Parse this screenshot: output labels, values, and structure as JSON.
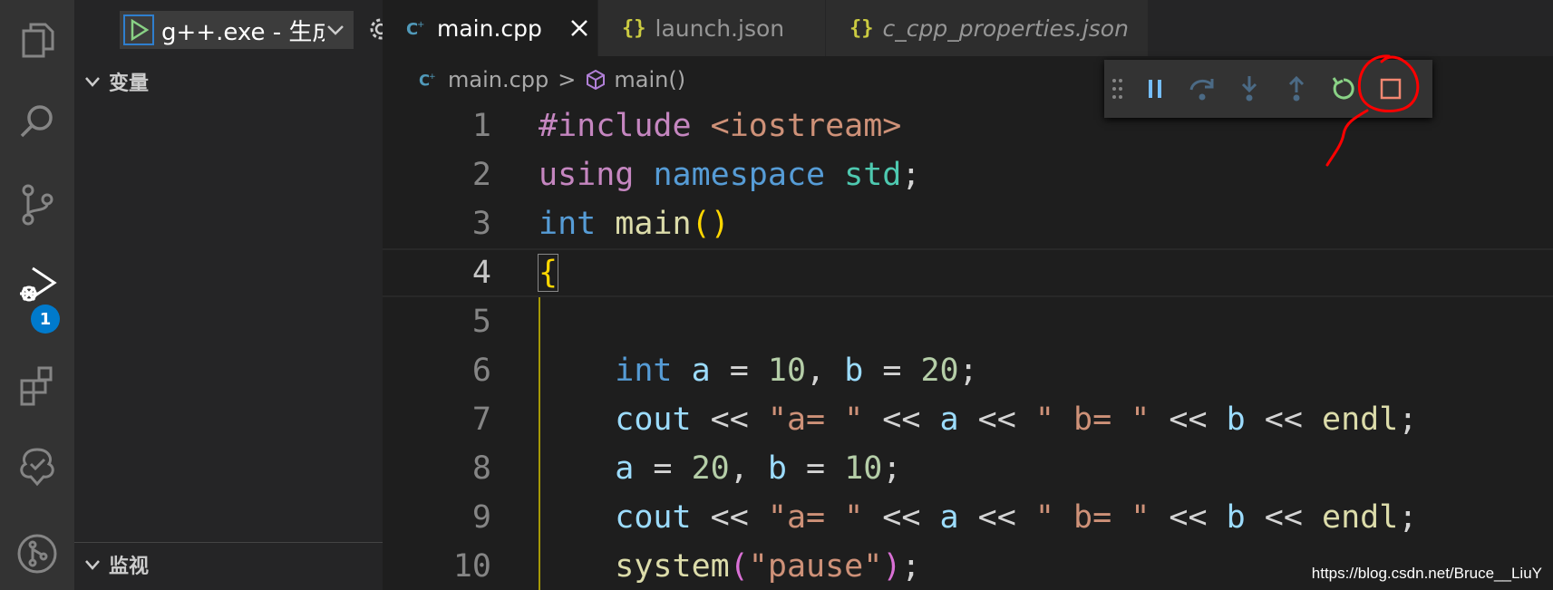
{
  "sidebar": {
    "config_label": "g++.exe - 生成",
    "variables_title": "变量",
    "watch_title": "监视",
    "debug_badge": "1"
  },
  "tabs": [
    {
      "label": "main.cpp",
      "icon": "cpp-file-icon",
      "active": true
    },
    {
      "label": "launch.json",
      "icon": "json-braces-icon",
      "active": false
    },
    {
      "label": "c_cpp_properties.json",
      "icon": "json-braces-icon",
      "active": false
    }
  ],
  "breadcrumb": {
    "file": "main.cpp",
    "sep": ">",
    "symbol": "main()"
  },
  "editor": {
    "lines": [
      {
        "n": "1"
      },
      {
        "n": "2"
      },
      {
        "n": "3"
      },
      {
        "n": "4"
      },
      {
        "n": "5"
      },
      {
        "n": "6"
      },
      {
        "n": "7"
      },
      {
        "n": "8"
      },
      {
        "n": "9"
      },
      {
        "n": "10"
      }
    ],
    "tokens": {
      "l1_a": "#include ",
      "l1_b": "<iostream>",
      "l2_a": "using ",
      "l2_b": "namespace ",
      "l2_c": "std",
      "l2_d": ";",
      "l3_a": "int ",
      "l3_b": "main",
      "l3_c": "()",
      "l4_a": "{",
      "l6_a": "    int ",
      "l6_b": "a",
      "l6_c": " = ",
      "l6_d": "10",
      "l6_e": ", ",
      "l6_f": "b",
      "l6_g": " = ",
      "l6_h": "20",
      "l6_i": ";",
      "l7_a": "    cout",
      "l7_b": " << ",
      "l7_c": "\"a= \"",
      "l7_d": " << ",
      "l7_e": "a",
      "l7_f": " << ",
      "l7_g": "\" b= \"",
      "l7_h": " << ",
      "l7_i": "b",
      "l7_j": " << ",
      "l7_k": "endl",
      "l7_l": ";",
      "l8_a": "    a",
      "l8_b": " = ",
      "l8_c": "20",
      "l8_d": ", ",
      "l8_e": "b",
      "l8_f": " = ",
      "l8_g": "10",
      "l8_h": ";",
      "l9_a": "    cout",
      "l9_b": " << ",
      "l9_c": "\"a= \"",
      "l9_d": " << ",
      "l9_e": "a",
      "l9_f": " << ",
      "l9_g": "\" b= \"",
      "l9_h": " << ",
      "l9_i": "b",
      "l9_j": " << ",
      "l9_k": "endl",
      "l9_l": ";",
      "l10_a": "    system",
      "l10_b": "(",
      "l10_c": "\"pause\"",
      "l10_d": ")",
      "l10_e": ";"
    }
  },
  "colors": {
    "accent": "#007acc",
    "annotation": "#ff0000"
  },
  "watermark": "https://blog.csdn.net/Bruce__LiuY"
}
